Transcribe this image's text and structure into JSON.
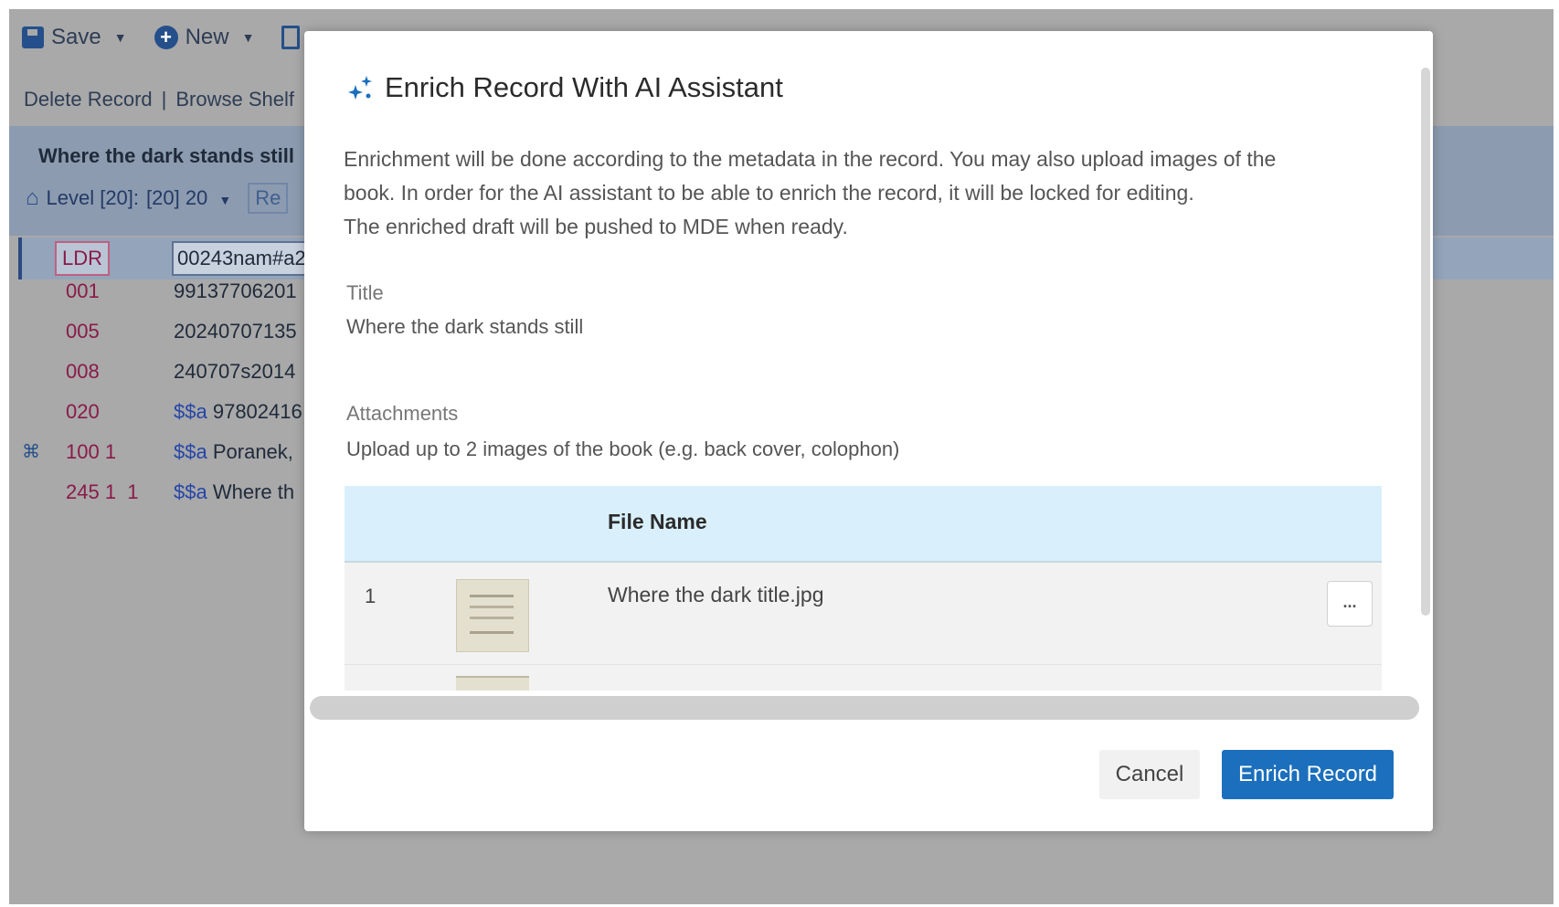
{
  "editor": {
    "toolbar": {
      "save_label": "Save",
      "new_label": "New"
    },
    "actions": {
      "delete_record": "Delete Record",
      "separator": "|",
      "browse_shelf": "Browse Shelf"
    },
    "record_title": "Where the dark stands still",
    "level": {
      "label": "Level [20]:",
      "value": "[20] 20",
      "button": "Re"
    },
    "fields": [
      {
        "tag": "LDR",
        "value": "00243nam#a2"
      },
      {
        "tag": "001",
        "value": "99137706201"
      },
      {
        "tag": "005",
        "value": "20240707135"
      },
      {
        "tag": "008",
        "value": "240707s2014"
      },
      {
        "tag": "020",
        "subfield": "$$a",
        "value": "97802416"
      },
      {
        "tag": "100 1",
        "subfield": "$$a",
        "value": "Poranek,"
      },
      {
        "tag": "245 1  1",
        "subfield": "$$a",
        "value": "Where th"
      }
    ]
  },
  "modal": {
    "title": "Enrich Record With AI Assistant",
    "description_lines": [
      "Enrichment will be done according to the metadata in the record. You may also upload images of the",
      "book. In order for the AI assistant to be able to enrich the record, it will be locked for editing.",
      "The enriched draft will be pushed to MDE when ready."
    ],
    "title_label": "Title",
    "title_value": "Where the dark stands still",
    "attachments_label": "Attachments",
    "attachments_hint": "Upload up to 2 images of the book (e.g. back cover, colophon)",
    "table": {
      "header_file_name": "File Name",
      "rows": [
        {
          "index": "1",
          "file_name": "Where the dark title.jpg",
          "menu": "..."
        }
      ]
    },
    "buttons": {
      "cancel": "Cancel",
      "enrich": "Enrich Record"
    }
  },
  "colors": {
    "primary": "#1b6fbc",
    "table_header": "#d9f0fc",
    "overlay_dim": "#a9a9a9",
    "marc_tag": "#8a1a48",
    "subfield": "#2545a8"
  },
  "icons": [
    "save-icon",
    "new-icon",
    "document-icon",
    "home-icon",
    "binoculars-icon",
    "sparkle-icon",
    "more-icon"
  ]
}
